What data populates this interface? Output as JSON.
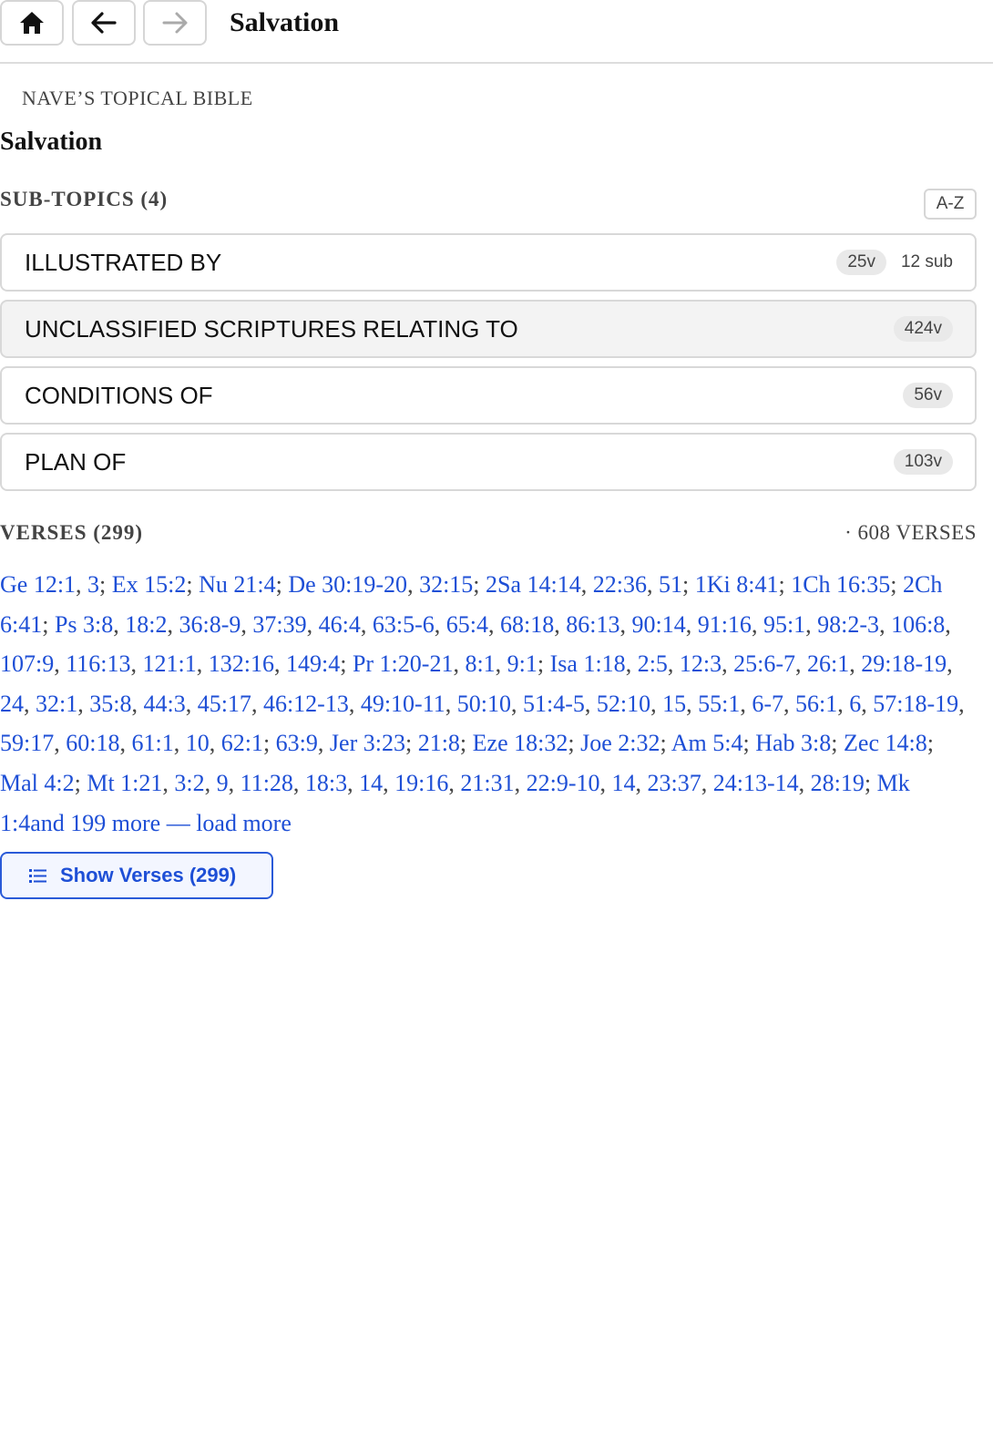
{
  "header": {
    "title": "Salvation",
    "home_icon": "home-icon",
    "back_icon": "arrow-left-icon",
    "forward_icon": "arrow-right-icon"
  },
  "main": {
    "source": "NAVE’S TOPICAL BIBLE",
    "title": "Salvation",
    "subtopics_heading": "SUB-TOPICS (4)",
    "sort_label": "A-Z",
    "subtopics": [
      {
        "label": "ILLUSTRATED BY",
        "verses": "25v",
        "sub": "12 sub"
      },
      {
        "label": "UNCLASSIFIED SCRIPTURES RELATING TO",
        "verses": "424v"
      },
      {
        "label": "CONDITIONS OF",
        "verses": "56v"
      },
      {
        "label": "PLAN OF",
        "verses": "103v"
      }
    ],
    "verses_heading": "VERSES (299)",
    "verses_total": "· 608 VERSES",
    "references": [
      "Ge 12:1",
      "3",
      "Ex 15:2",
      "Nu 21:4",
      "De 30:19-20",
      "32:15",
      "2Sa 14:14",
      "22:36",
      "51",
      "1Ki 8:41",
      "1Ch 16:35",
      "2Ch 6:41",
      "Ps 3:8",
      "18:2",
      "36:8-9",
      "37:39",
      "46:4",
      "63:5-6",
      "65:4",
      "68:18",
      "86:13",
      "90:14",
      "91:16",
      "95:1",
      "98:2-3",
      "106:8",
      "107:9",
      "116:13",
      "121:1",
      "132:16",
      "149:4",
      "Pr 1:20-21",
      "8:1",
      "9:1",
      "Isa 1:18",
      "2:5",
      "12:3",
      "25:6-7",
      "26:1",
      "29:18-19",
      "24",
      "32:1",
      "35:8",
      "44:3",
      "45:17",
      "46:12-13",
      "49:10-11",
      "50:10",
      "51:4-5",
      "52:10",
      "15",
      "55:1",
      "6-7",
      "56:1",
      "6",
      "57:18-19",
      "59:17",
      "60:18",
      "61:1",
      "10",
      "62:1",
      "63:9",
      "Jer 3:23",
      "21:8",
      "Eze 18:32",
      "Joe 2:32",
      "Am 5:4",
      "Hab 3:8",
      "Zec 14:8",
      "Mal 4:2",
      "Mt 1:21",
      "3:2",
      "9",
      "11:28",
      "18:3",
      "14",
      "19:16",
      "21:31",
      "22:9-10",
      "14",
      "23:37",
      "24:13-14",
      "28:19",
      "Mk 1:4"
    ],
    "separators": [
      ", ",
      "; ",
      "; ",
      "; ",
      ", ",
      "; ",
      ", ",
      ", ",
      "; ",
      "; ",
      "; ",
      "; ",
      ", ",
      ", ",
      ", ",
      ", ",
      ", ",
      ", ",
      ", ",
      ", ",
      ", ",
      ", ",
      ", ",
      ", ",
      ", ",
      ", ",
      ", ",
      ", ",
      ", ",
      ", ",
      "; ",
      ", ",
      ", ",
      "; ",
      ", ",
      ", ",
      ", ",
      ", ",
      ", ",
      ", ",
      ", ",
      ", ",
      ", ",
      ", ",
      ", ",
      ", ",
      ", ",
      ", ",
      ", ",
      ", ",
      ", ",
      ", ",
      ", ",
      ", ",
      ", ",
      ", ",
      ", ",
      ", ",
      ", ",
      ", ",
      "; ",
      ", ",
      "; ",
      "; ",
      "; ",
      "; ",
      "; ",
      "; ",
      "; ",
      "; ",
      ", ",
      ", ",
      ", ",
      ", ",
      ", ",
      ", ",
      ", ",
      ", ",
      ", ",
      ", ",
      ", ",
      ", ",
      "; ",
      ""
    ],
    "more_text": "and 199 more — load more",
    "show_verses_label": "Show Verses (299)"
  },
  "colors": {
    "link": "#1e4fd6",
    "active_row": "#f3f3f3",
    "pill": "#e9e9e9"
  }
}
